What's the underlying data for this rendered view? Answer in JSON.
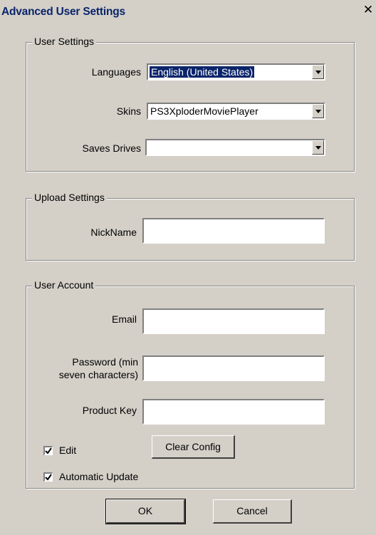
{
  "window": {
    "title": "Advanced User Settings",
    "close_glyph": "✕"
  },
  "user_settings": {
    "legend": "User Settings",
    "languages_label": "Languages",
    "languages_value": "English (United States)",
    "skins_label": "Skins",
    "skins_value": "PS3XploderMoviePlayer",
    "saves_drives_label": "Saves Drives",
    "saves_drives_value": ""
  },
  "upload_settings": {
    "legend": "Upload Settings",
    "nickname_label": "NickName",
    "nickname_value": ""
  },
  "user_account": {
    "legend": "User Account",
    "email_label": "Email",
    "password_label_line1": "Password (min",
    "password_label_line2": "seven characters)",
    "product_key_label": "Product Key",
    "edit_label": "Edit",
    "edit_checked": true,
    "auto_update_label": "Automatic Update",
    "auto_update_checked": true,
    "clear_config_label": "Clear Config"
  },
  "footer": {
    "ok_label": "OK",
    "cancel_label": "Cancel"
  },
  "icons": {
    "dropdown": "chevron-down-icon",
    "check": "checkmark-icon",
    "close": "close-icon"
  }
}
